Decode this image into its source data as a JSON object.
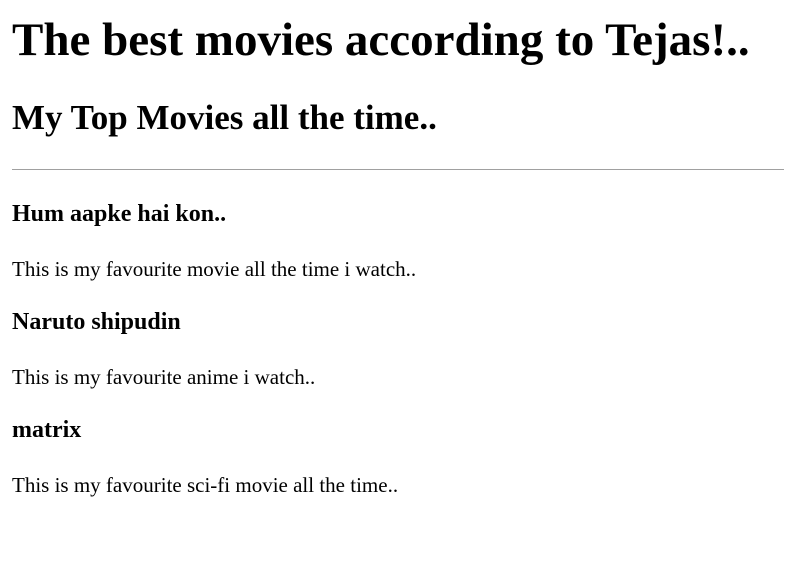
{
  "page": {
    "title": "The best movies according to Tejas!..",
    "subtitle": "My Top Movies all the time.."
  },
  "movies": [
    {
      "title": "Hum aapke hai kon..",
      "description": "This is my favourite movie all the time i watch.."
    },
    {
      "title": "Naruto shipudin",
      "description": "This is my favourite anime i watch.."
    },
    {
      "title": "matrix",
      "description": "This is my favourite sci-fi movie all the time.."
    }
  ]
}
